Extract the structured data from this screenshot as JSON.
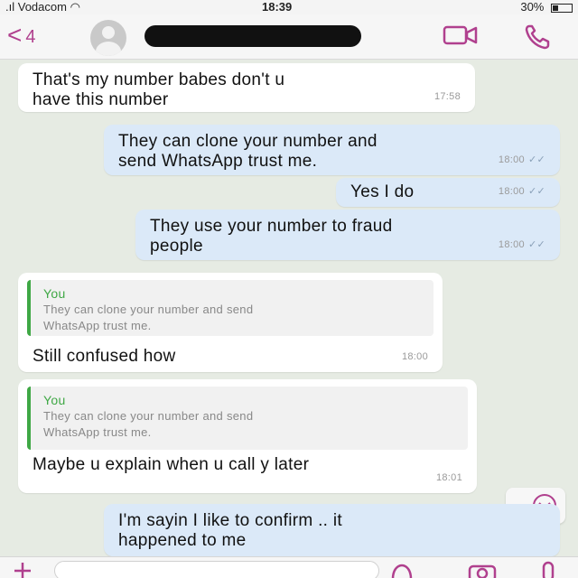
{
  "status_bar": {
    "carrier": "Vodacom",
    "time": "18:39",
    "battery": "30%",
    "battery_level": 0.3
  },
  "header": {
    "back_count": "4",
    "icons": [
      "back-chevron-icon",
      "video-call-icon",
      "phone-icon"
    ]
  },
  "messages": [
    {
      "direction": "in",
      "text": "That's my number babes don't u\nhave this number",
      "time": "17:58"
    },
    {
      "direction": "out",
      "text": "They can clone your number and\nsend WhatsApp trust me.",
      "time": "18:00"
    },
    {
      "direction": "out",
      "text": "Yes I do",
      "time": "18:00"
    },
    {
      "direction": "out",
      "text": "They use your number to fraud\npeople",
      "time": "18:00"
    },
    {
      "direction": "in",
      "quote_author": "You",
      "quote_text": "They can clone your number and send\nWhatsApp trust me.",
      "text": "Still confused how",
      "time": "18:00"
    },
    {
      "direction": "in",
      "quote_author": "You",
      "quote_text": "They can clone your number and send\nWhatsApp trust me.",
      "text": "Maybe u explain when u call y later",
      "time": "18:01"
    },
    {
      "direction": "out",
      "text": "I'm sayin I like to confirm .. it\nhappened to me",
      "time": ""
    }
  ],
  "colors": {
    "accent": "#b0408e",
    "outgoing_bubble": "#dbe9f8",
    "incoming_bubble": "#ffffff",
    "quote_bar": "#3fa845",
    "chat_background": "#e6ebe3"
  }
}
